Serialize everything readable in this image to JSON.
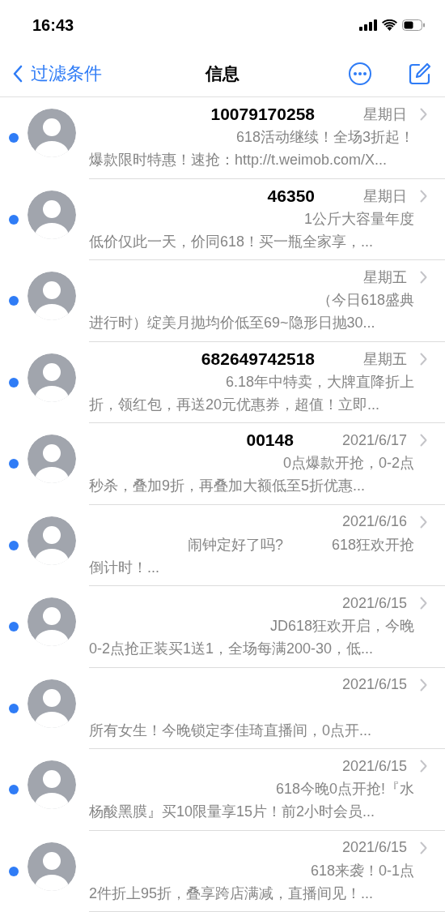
{
  "status_bar": {
    "time": "16:43"
  },
  "nav": {
    "back_label": "过滤条件",
    "title": "信息"
  },
  "messages": [
    {
      "sender": "10079170258",
      "date": "星期日",
      "line1": [
        "618活动继续！全场3折起！"
      ],
      "line2": "爆款限时特惠！速抢：http://t.weimob.com/X...",
      "unread": true
    },
    {
      "sender": "46350",
      "date": "星期日",
      "line1": [
        "1公斤大容量年度"
      ],
      "line2": "低价仅此一天，价同618！买一瓶全家享，...",
      "unread": true
    },
    {
      "date": "星期五",
      "line1": [
        "（今日618盛典"
      ],
      "line2": "进行时）绽美月抛均价低至69~隐形日抛30...",
      "unread": true
    },
    {
      "sender": "682649742518",
      "date": "星期五",
      "line1": [
        "6.18年中特卖，大牌直降折上"
      ],
      "line2": "折，领红包，再送20元优惠券，超值！立即...",
      "unread": true
    },
    {
      "sender": "00148",
      "date": "2021/6/17",
      "line1": [
        "0点爆款开抢，0-2点"
      ],
      "line2": "秒杀，叠加9折，再叠加大额低至5折优惠...",
      "unread": true
    },
    {
      "date": "2021/6/16",
      "line1": [
        "闹钟定好了吗?",
        "618狂欢开抢"
      ],
      "line2": "倒计时！...",
      "unread": true
    },
    {
      "date": "2021/6/15",
      "line1": [
        "JD618狂欢开启，今晚"
      ],
      "line2": "0-2点抢正装买1送1，全场每满200-30，低...",
      "unread": true
    },
    {
      "date": "2021/6/15",
      "line2": "所有女生！今晚锁定李佳琦直播间，0点开...",
      "unread": true
    },
    {
      "date": "2021/6/15",
      "line1": [
        "618今晚0点开抢!『水"
      ],
      "line2": "杨酸黑膜』买10限量享15片！前2小时会员...",
      "unread": true
    },
    {
      "date": "2021/6/15",
      "line1": [
        "618来袭！0-1点"
      ],
      "line2": "2件折上95折，叠享跨店满减，直播间见！...",
      "unread": true
    }
  ]
}
